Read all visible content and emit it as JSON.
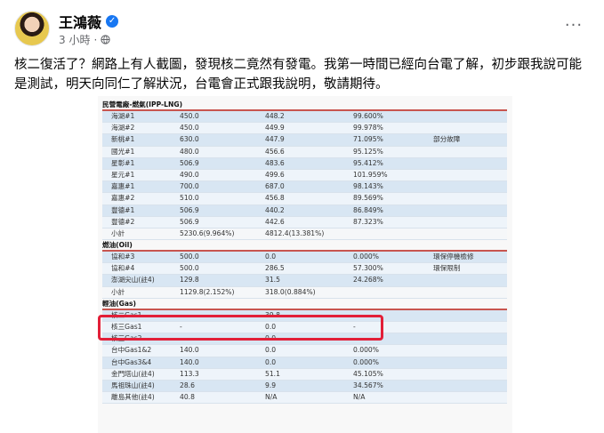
{
  "post": {
    "author": "王鴻薇",
    "time": "3 小時",
    "dot": "·",
    "more": "···",
    "text": "核二復活了？網路上有人截圖，發現核二竟然有發電。我第一時間已經向台電了解，初步跟我說可能是測試，明天向同仁了解狀況，台電會正式跟我說明，敬請期待。"
  },
  "table": {
    "sections": [
      {
        "title": "民營電廠-燃氣(IPP-LNG)",
        "rows": [
          [
            "海湖#1",
            "450.0",
            "448.2",
            "99.600%",
            ""
          ],
          [
            "海湖#2",
            "450.0",
            "449.9",
            "99.978%",
            ""
          ],
          [
            "新桃#1",
            "630.0",
            "447.9",
            "71.095%",
            "部分故障"
          ],
          [
            "國光#1",
            "480.0",
            "456.6",
            "95.125%",
            ""
          ],
          [
            "星彰#1",
            "506.9",
            "483.6",
            "95.412%",
            ""
          ],
          [
            "星元#1",
            "490.0",
            "499.6",
            "101.959%",
            ""
          ],
          [
            "嘉惠#1",
            "700.0",
            "687.0",
            "98.143%",
            ""
          ],
          [
            "嘉惠#2",
            "510.0",
            "456.8",
            "89.569%",
            ""
          ],
          [
            "豐德#1",
            "506.9",
            "440.2",
            "86.849%",
            ""
          ],
          [
            "豐德#2",
            "506.9",
            "442.6",
            "87.323%",
            ""
          ],
          [
            "小計",
            "5230.6(9.964%)",
            "4812.4(13.381%)",
            "",
            ""
          ]
        ]
      },
      {
        "title": "燃油(Oil)",
        "rows": [
          [
            "協和#3",
            "500.0",
            "0.0",
            "0.000%",
            "環保停機檢修"
          ],
          [
            "協和#4",
            "500.0",
            "286.5",
            "57.300%",
            "環保限制"
          ],
          [
            "澎湖尖山(註4)",
            "129.8",
            "31.5",
            "24.268%",
            ""
          ],
          [
            "小計",
            "1129.8(2.152%)",
            "318.0(0.884%)",
            "",
            ""
          ]
        ]
      },
      {
        "title": "輕油(Gas)",
        "rows": [
          [
            "核二Gas1",
            "-",
            "39.8",
            "-",
            ""
          ],
          [
            "核三Gas1",
            "-",
            "0.0",
            "-",
            ""
          ],
          [
            "核三Gas2",
            "-",
            "0.0",
            "-",
            ""
          ],
          [
            "台中Gas1&2",
            "140.0",
            "0.0",
            "0.000%",
            ""
          ],
          [
            "台中Gas3&4",
            "140.0",
            "0.0",
            "0.000%",
            ""
          ],
          [
            "金門塔山(註4)",
            "113.3",
            "51.1",
            "45.105%",
            ""
          ],
          [
            "馬祖珠山(註4)",
            "28.6",
            "9.9",
            "34.567%",
            ""
          ],
          [
            "離島其他(註4)",
            "40.8",
            "N/A",
            "N/A",
            ""
          ]
        ]
      }
    ]
  },
  "highlight": {
    "color": "#e21f38"
  }
}
